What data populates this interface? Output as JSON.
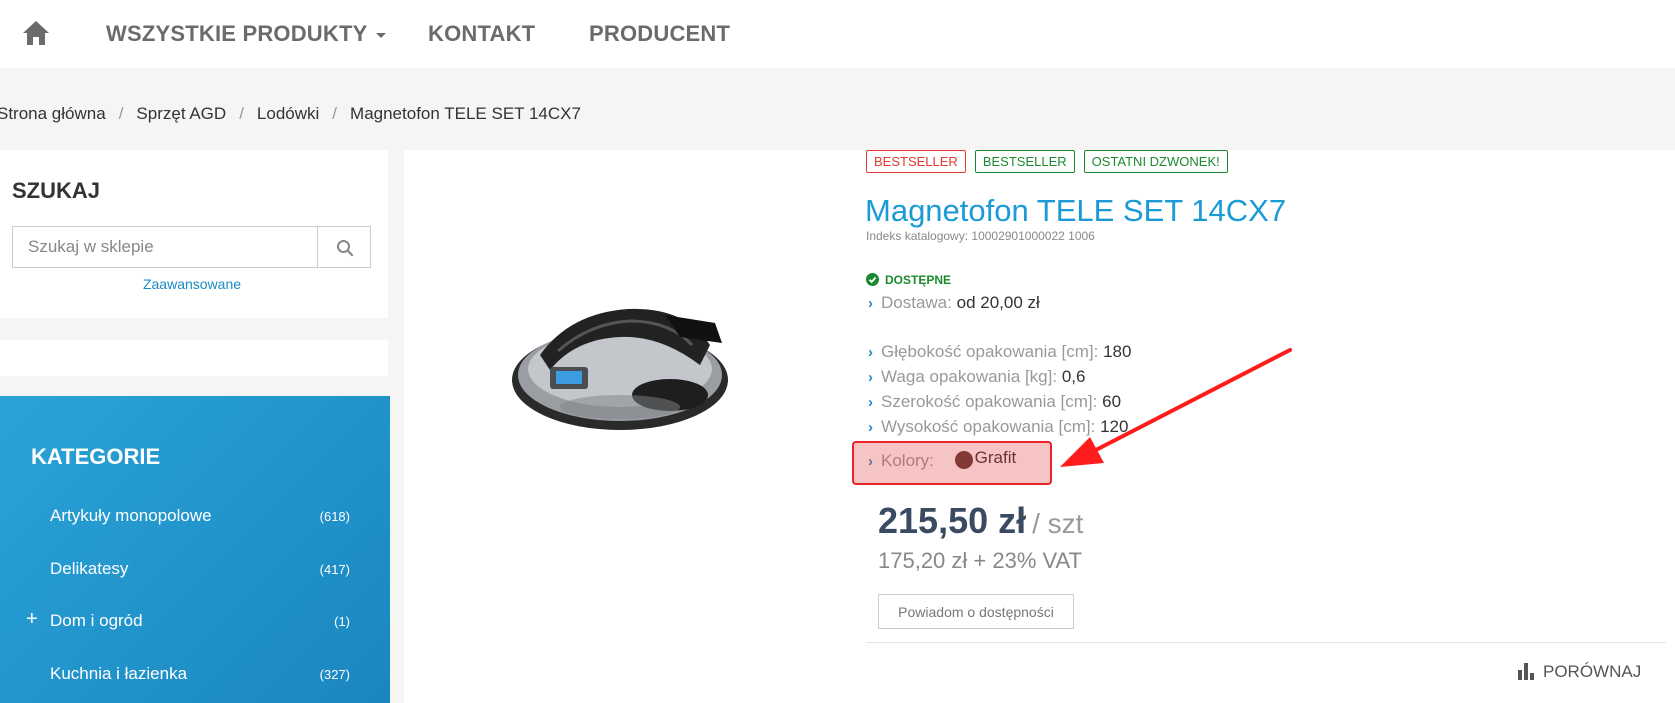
{
  "nav": {
    "home_icon": "home-icon",
    "items": [
      "WSZYSTKIE PRODUKTY",
      "KONTAKT",
      "PRODUCENT"
    ]
  },
  "breadcrumb": [
    "Strona główna",
    "Sprzęt AGD",
    "Lodówki",
    "Magnetofon TELE SET 14CX7"
  ],
  "search": {
    "title": "SZUKAJ",
    "placeholder": "Szukaj w sklepie",
    "advanced": "Zaawansowane"
  },
  "categories": {
    "title": "KATEGORIE",
    "items": [
      {
        "label": "Artykuły monopolowe",
        "count": "(618)"
      },
      {
        "label": "Delikatesy",
        "count": "(417)"
      },
      {
        "label": "Dom i ogród",
        "count": "(1)",
        "expand": "+"
      },
      {
        "label": "Kuchnia i łazienka",
        "count": "(327)"
      }
    ]
  },
  "product": {
    "badges": [
      "BESTSELLER",
      "BESTSELLER",
      "OSTATNI DZWONEK!"
    ],
    "title": "Magnetofon TELE SET 14CX7",
    "catalog_index": "Indeks katalogowy: 10002901000022 1006",
    "availability": "DOSTĘPNE",
    "delivery": {
      "label": "Dostawa:",
      "value": "od 20,00 zł"
    },
    "attributes": [
      {
        "label": "Głębokość opakowania [cm]:",
        "value": "180"
      },
      {
        "label": "Waga opakowania [kg]:",
        "value": "0,6"
      },
      {
        "label": "Szerokość opakowania [cm]:",
        "value": "60"
      },
      {
        "label": "Wysokość opakowania [cm]:",
        "value": "120"
      }
    ],
    "colors": {
      "label": "Kolory:",
      "value": "Grafit",
      "swatch": "#5a3a36"
    },
    "price": "215,50 zł",
    "price_unit": "/ szt",
    "net_price": "175,20 zł + 23% VAT",
    "notify_label": "Powiadom o dostępności",
    "compare_label": "PORÓWNAJ"
  },
  "colors": {
    "accent": "#1a9bd7",
    "sidebar": "#1f92ca",
    "available": "#1b8a2f",
    "highlight": "#e8232a"
  }
}
